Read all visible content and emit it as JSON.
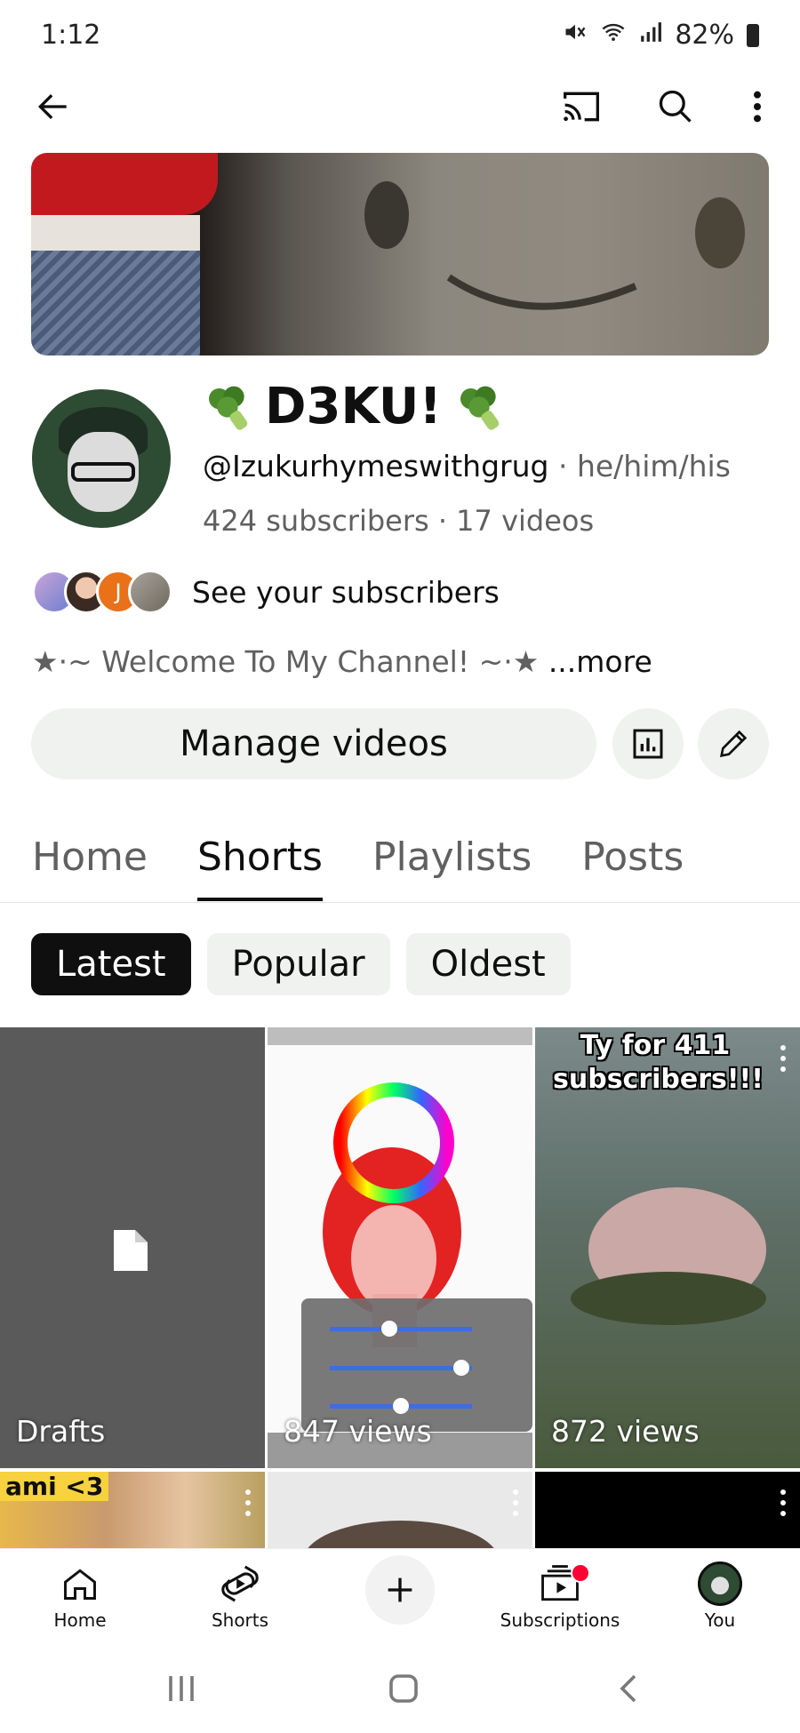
{
  "status": {
    "time": "1:12",
    "battery": "82%"
  },
  "channel": {
    "name": "D3KU!",
    "handle": "@Izukurhymeswithgrug",
    "pronouns": "he/him/his",
    "stats": "424 subscribers · 17 videos",
    "see_subscribers": "See your subscribers",
    "description": "★·~ Welcome To My Channel! ~·★",
    "more": "...more",
    "manage_label": "Manage videos"
  },
  "tabs": [
    {
      "label": "Home"
    },
    {
      "label": "Shorts"
    },
    {
      "label": "Playlists"
    },
    {
      "label": "Posts"
    }
  ],
  "chips": [
    {
      "label": "Latest"
    },
    {
      "label": "Popular"
    },
    {
      "label": "Oldest"
    }
  ],
  "shorts": [
    {
      "label": "Drafts"
    },
    {
      "views": "847 views"
    },
    {
      "title": "Ty for 411 subscribers!!!",
      "views": "872 views"
    },
    {
      "title": "ami <3"
    }
  ],
  "nav": [
    {
      "label": "Home"
    },
    {
      "label": "Shorts"
    },
    {
      "label": "Subscriptions"
    },
    {
      "label": "You"
    }
  ],
  "colors": {
    "accent_red": "#ff0033",
    "chip_bg": "#f0f2ef",
    "text": "#0f0f0f",
    "muted": "#606060"
  }
}
